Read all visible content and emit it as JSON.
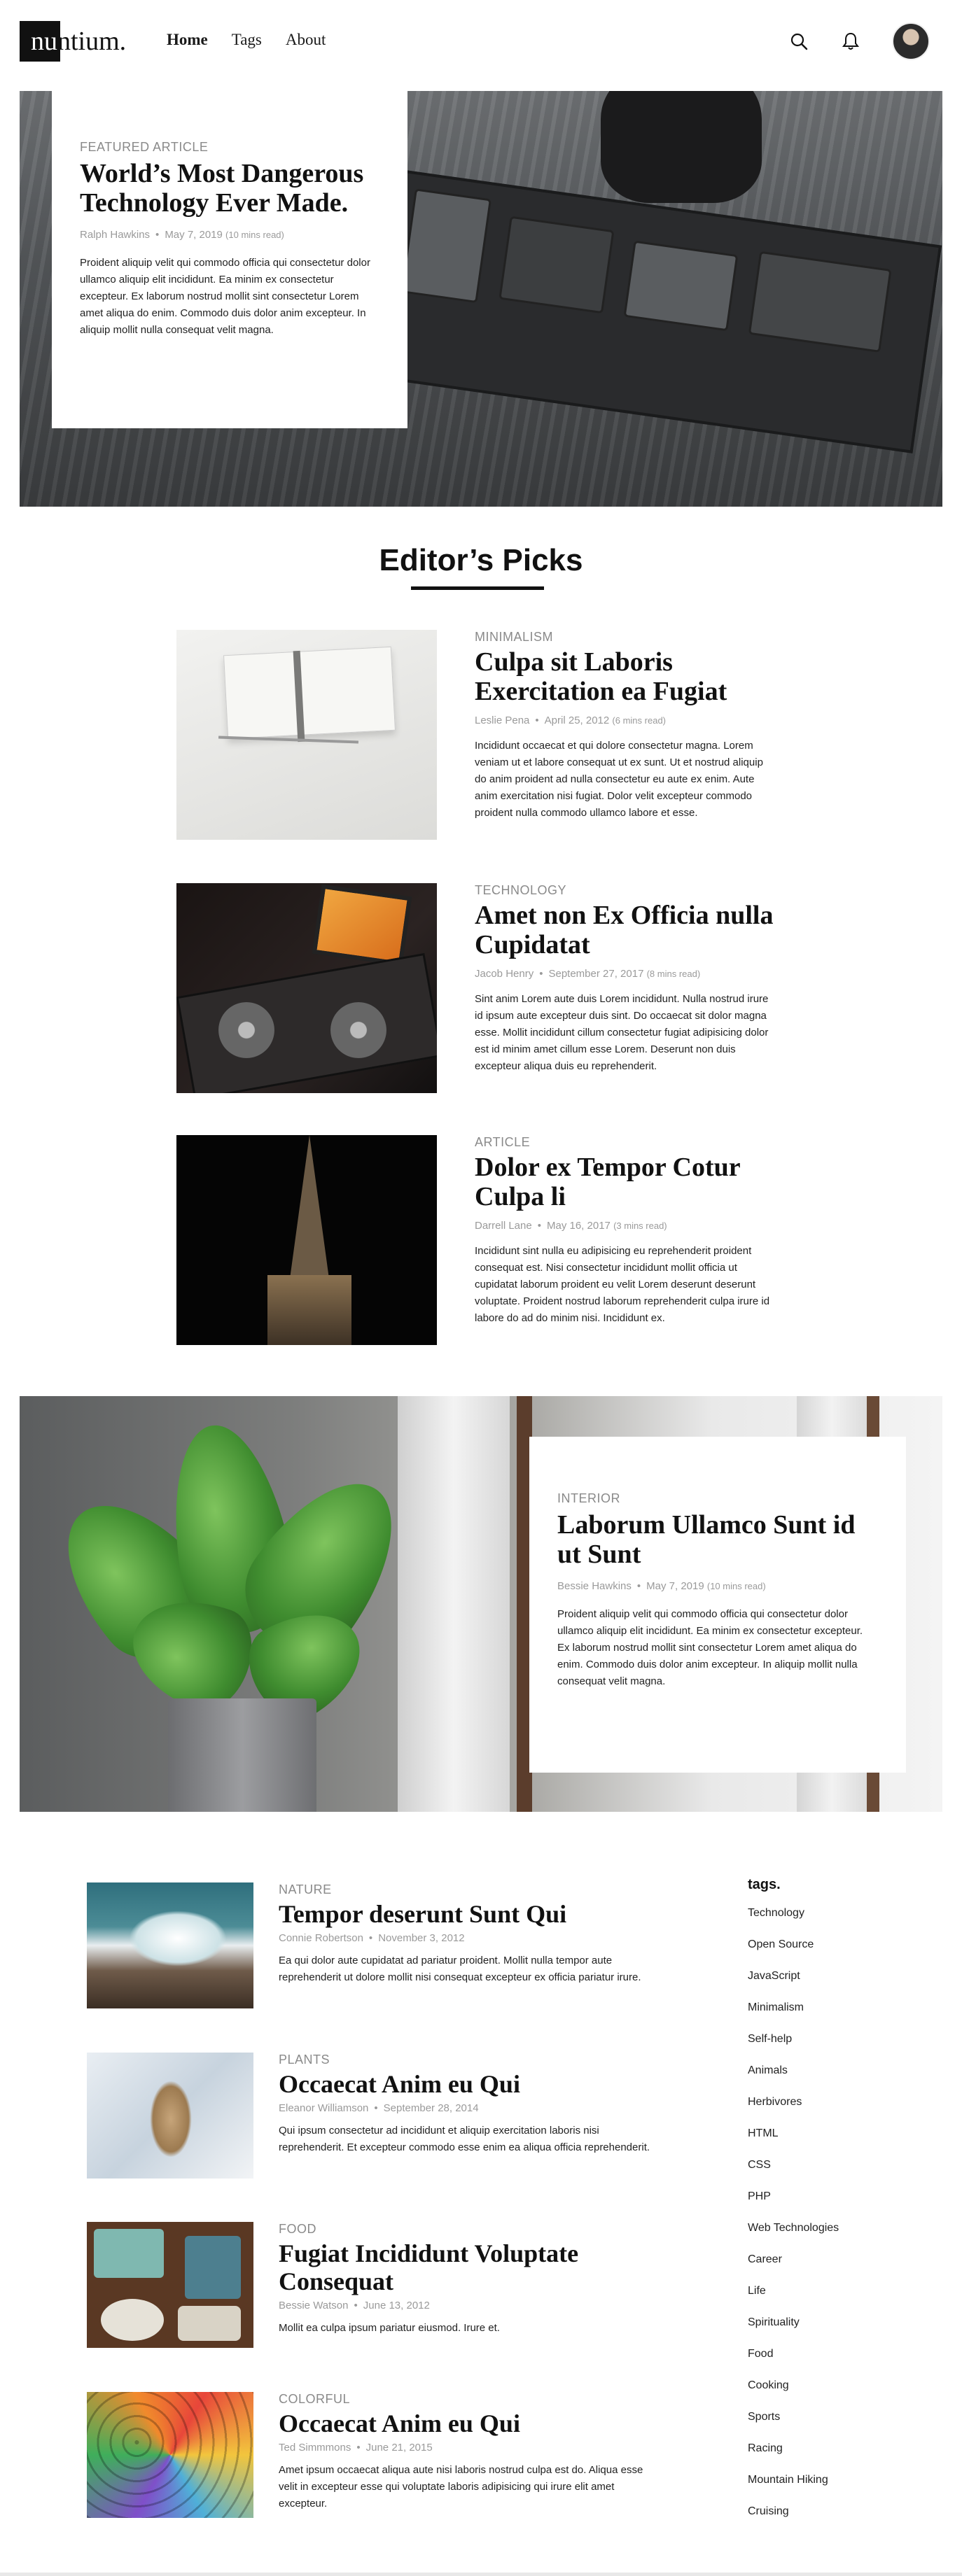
{
  "brand": {
    "logo_first": "nu",
    "logo_rest": "ntium."
  },
  "nav": {
    "items": [
      {
        "label": "Home",
        "active": true
      },
      {
        "label": "Tags",
        "active": false
      },
      {
        "label": "About",
        "active": false
      }
    ]
  },
  "header_icons": [
    "search-icon",
    "bell-icon",
    "avatar"
  ],
  "featured": {
    "kicker": "FEATURED ARTICLE",
    "title": "World’s Most Dangerous Technology Ever Made.",
    "author": "Ralph Hawkins",
    "date": "May 7, 2019",
    "read": "(10 mins read)",
    "excerpt": "Proident aliquip velit qui commodo officia qui consectetur dolor ullamco aliquip elit incididunt. Ea minim ex consectetur excepteur. Ex laborum nostrud mollit sint consectetur Lorem amet aliqua do enim. Commodo duis dolor anim excepteur. In aliquip mollit nulla consequat velit magna."
  },
  "editors_picks": {
    "heading": "Editor’s Picks",
    "items": [
      {
        "kicker": "MINIMALISM",
        "title": "Culpa sit Laboris Exercitation ea Fugiat",
        "author": "Leslie Pena",
        "date": "April 25, 2012",
        "read": "(6 mins read)",
        "excerpt": "Incididunt occaecat et qui dolore consectetur magna. Lorem veniam ut et labore consequat ut ex sunt. Ut et nostrud aliquip do anim proident ad nulla consectetur eu aute ex enim. Aute anim exercitation nisi fugiat. Dolor velit excepteur commodo proident nulla commodo ullamco labore et esse."
      },
      {
        "kicker": "TECHNOLOGY",
        "title": "Amet non Ex Officia nulla Cupidatat",
        "author": "Jacob Henry",
        "date": "September 27, 2017",
        "read": "(8 mins read)",
        "excerpt": "Sint anim Lorem aute duis Lorem incididunt. Nulla nostrud irure id ipsum aute excepteur duis sint. Do occaecat sit dolor magna esse. Mollit incididunt cillum consectetur fugiat adipisicing dolor est id minim amet cillum esse Lorem. Deserunt non duis excepteur aliqua duis eu reprehenderit."
      },
      {
        "kicker": "ARTICLE",
        "title": "Dolor ex Tempor Cotur Culpa li",
        "author": "Darrell Lane",
        "date": "May 16, 2017",
        "read": "(3 mins read)",
        "excerpt": "Incididunt sint nulla eu adipisicing eu reprehenderit proident consequat est. Nisi consectetur incididunt mollit officia ut cupidatat laborum proident eu velit Lorem deserunt deserunt voluptate. Proident nostrud laborum reprehenderit culpa irure id labore do ad do minim nisi. Incididunt ex."
      }
    ]
  },
  "interior": {
    "kicker": "INTERIOR",
    "title": "Laborum Ullamco Sunt id ut Sunt",
    "author": "Bessie Hawkins",
    "date": "May 7, 2019",
    "read": "(10 mins read)",
    "excerpt": "Proident aliquip velit qui commodo officia qui consectetur dolor ullamco aliquip elit incididunt. Ea minim ex consectetur excepteur. Ex laborum nostrud mollit sint consectetur Lorem amet aliqua do enim. Commodo duis dolor anim excepteur. In aliquip mollit nulla consequat velit magna."
  },
  "recent": [
    {
      "kicker": "NATURE",
      "title": "Tempor deserunt Sunt Qui",
      "author": "Connie Robertson",
      "date": "November 3, 2012",
      "excerpt": "Ea qui dolor aute cupidatat ad pariatur proident. Mollit nulla tempor aute reprehenderit ut dolore mollit nisi consequat excepteur ex officia pariatur irure."
    },
    {
      "kicker": "PLANTS",
      "title": "Occaecat Anim eu Qui",
      "author": "Eleanor Williamson",
      "date": "September 28, 2014",
      "excerpt": "Qui ipsum consectetur ad incididunt et aliquip exercitation laboris nisi reprehenderit. Et excepteur commodo esse enim ea aliqua officia reprehenderit."
    },
    {
      "kicker": "FOOD",
      "title": "Fugiat Incididunt Voluptate Consequat",
      "author": "Bessie Watson",
      "date": "June 13, 2012",
      "excerpt": "Mollit ea culpa ipsum pariatur eiusmod. Irure et."
    },
    {
      "kicker": "COLORFUL",
      "title": "Occaecat Anim eu Qui",
      "author": "Ted Simmmons",
      "date": "June 21, 2015",
      "excerpt": "Amet ipsum occaecat aliqua aute nisi laboris nostrud culpa est do. Aliqua esse velit in excepteur esse qui voluptate laboris adipisicing qui irure elit amet excepteur."
    }
  ],
  "tags": {
    "title": "tags.",
    "items": [
      "Technology",
      "Open Source",
      "JavaScript",
      "Minimalism",
      "Self-help",
      "Animals",
      "Herbivores",
      "HTML",
      "CSS",
      "PHP",
      "Web Technologies",
      "Career",
      "Life",
      "Spirituality",
      "Food",
      "Cooking",
      "Sports",
      "Racing",
      "Mountain Hiking",
      "Cruising"
    ]
  }
}
